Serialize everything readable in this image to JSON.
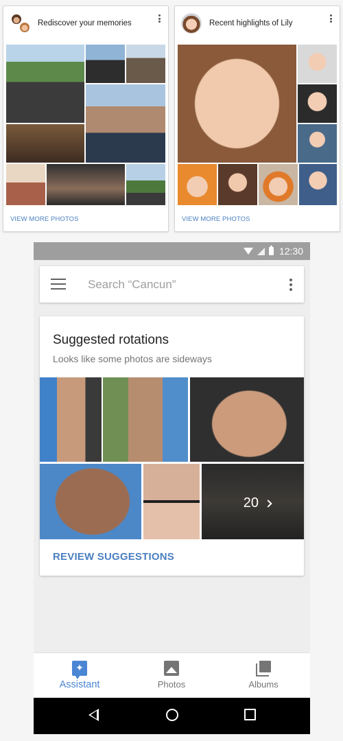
{
  "memories_card": {
    "title": "Rediscover your memories",
    "link": "VIEW MORE PHOTOS"
  },
  "highlights_card": {
    "title": "Recent highlights of Lily",
    "link": "VIEW MORE PHOTOS"
  },
  "status_bar": {
    "time": "12:30"
  },
  "search": {
    "placeholder": "Search “Cancun”"
  },
  "suggestion_card": {
    "title": "Suggested rotations",
    "subtitle": "Looks like some photos are sideways",
    "more_count": "20",
    "action": "REVIEW SUGGESTIONS"
  },
  "bottom_nav": {
    "items": [
      {
        "label": "Assistant",
        "icon": "assistant-icon",
        "active": true
      },
      {
        "label": "Photos",
        "icon": "photo-icon",
        "active": false
      },
      {
        "label": "Albums",
        "icon": "albums-icon",
        "active": false
      }
    ]
  },
  "colors": {
    "accent": "#4a86d4",
    "link": "#4a7fc1",
    "status_bar": "#9e9e9e",
    "system_nav": "#000000"
  }
}
